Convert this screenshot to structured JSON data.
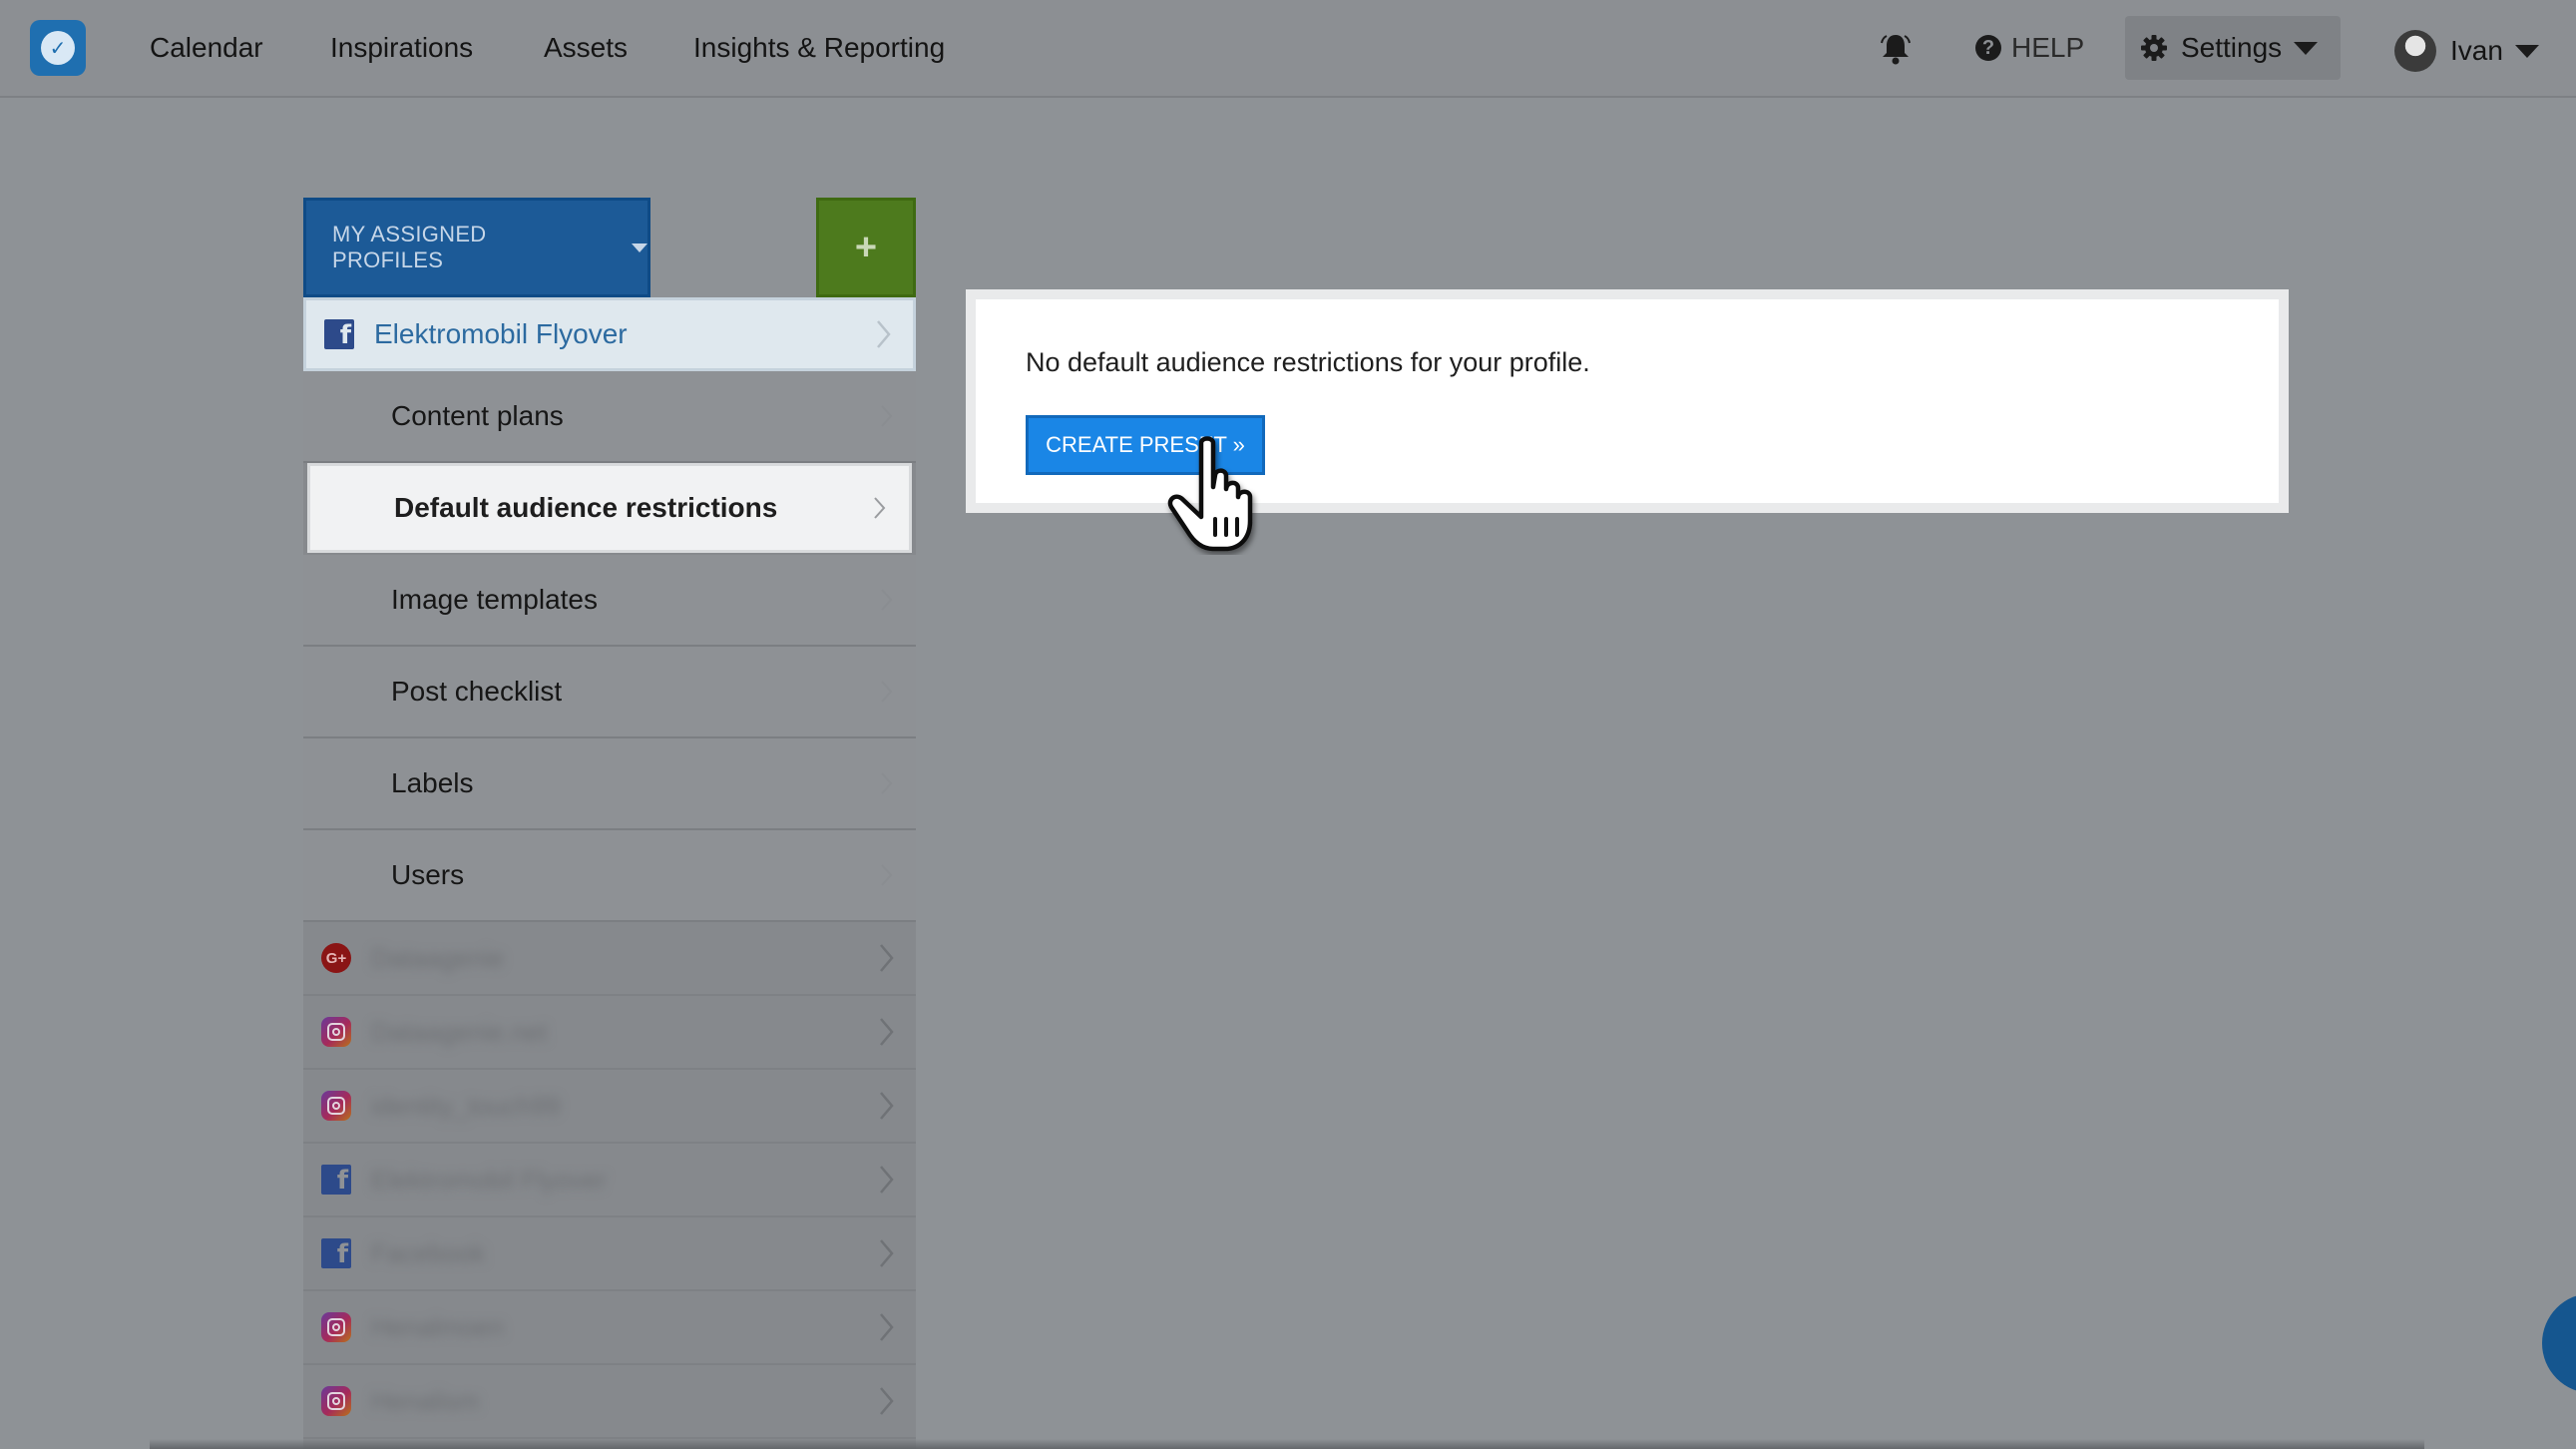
{
  "nav": {
    "links": [
      "Calendar",
      "Inspirations",
      "Assets",
      "Insights & Reporting"
    ],
    "help_label": "HELP",
    "settings_label": "Settings",
    "user_name": "Ivan"
  },
  "sidebar": {
    "profiles_button": "MY ASSIGNED PROFILES",
    "add_button": "+",
    "active_profile": {
      "network": "facebook",
      "name": "Elektromobil Flyover"
    },
    "sub_items": [
      {
        "label": "Content plans"
      },
      {
        "label": "Default audience restrictions",
        "selected": true
      },
      {
        "label": "Image templates"
      },
      {
        "label": "Post checklist"
      },
      {
        "label": "Labels"
      },
      {
        "label": "Users"
      }
    ],
    "other_profiles": [
      {
        "network": "google-plus",
        "name": "Dataagenie"
      },
      {
        "network": "instagram",
        "name": "Dataagenie.net"
      },
      {
        "network": "instagram",
        "name": "identity_touch99"
      },
      {
        "network": "facebook",
        "name": "Elektromobil Flyover"
      },
      {
        "network": "facebook",
        "name": "Facebook"
      },
      {
        "network": "instagram",
        "name": "Henalmoen"
      },
      {
        "network": "instagram",
        "name": "Henalism"
      }
    ]
  },
  "main": {
    "message": "No default audience restrictions for your profile.",
    "create_button": "CREATE PRESET »"
  },
  "colors": {
    "overlay_bg": "#8e9296",
    "primary_button": "#1a86e6",
    "profiles_button": "#1c5a97",
    "add_button": "#4d7a1d",
    "active_profile_text": "#2c6aa0"
  }
}
